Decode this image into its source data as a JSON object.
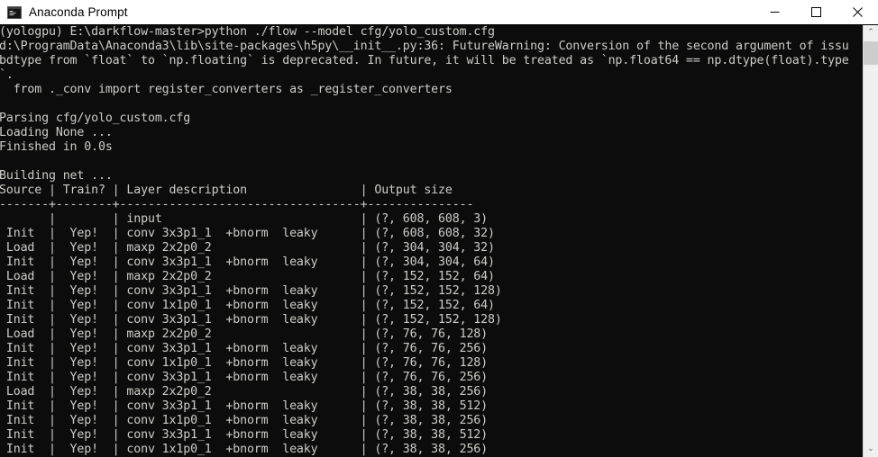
{
  "window": {
    "title": "Anaconda Prompt",
    "icon": "console-icon",
    "controls": {
      "minimize_label": "Minimize",
      "maximize_label": "Maximize",
      "close_label": "Close"
    }
  },
  "scrollbar": {
    "up_arrow": "⌃",
    "down_arrow": "⌄",
    "thumb_label": "scroll-thumb"
  },
  "console": {
    "prompt_line": "(yologpu) E:\\darkflow-master>python ./flow --model cfg/yolo_custom.cfg",
    "warning_lines": [
      "d:\\ProgramData\\Anaconda3\\lib\\site-packages\\h5py\\__init__.py:36: FutureWarning: Conversion of the second argument of issu",
      "bdtype from `float` to `np.floating` is deprecated. In future, it will be treated as `np.float64 == np.dtype(float).type",
      "`.",
      "  from ._conv import register_converters as _register_converters"
    ],
    "parse_lines": [
      "Parsing cfg/yolo_custom.cfg",
      "Loading None ...",
      "Finished in 0.0s"
    ],
    "building_line": "Building net ...",
    "table": {
      "header": "Source | Train? | Layer description                | Output size",
      "separator": "-------+--------+----------------------------------+---------------",
      "rows": [
        "       |        | input                            | (?, 608, 608, 3)",
        " Init  |  Yep!  | conv 3x3p1_1  +bnorm  leaky      | (?, 608, 608, 32)",
        " Load  |  Yep!  | maxp 2x2p0_2                     | (?, 304, 304, 32)",
        " Init  |  Yep!  | conv 3x3p1_1  +bnorm  leaky      | (?, 304, 304, 64)",
        " Load  |  Yep!  | maxp 2x2p0_2                     | (?, 152, 152, 64)",
        " Init  |  Yep!  | conv 3x3p1_1  +bnorm  leaky      | (?, 152, 152, 128)",
        " Init  |  Yep!  | conv 1x1p0_1  +bnorm  leaky      | (?, 152, 152, 64)",
        " Init  |  Yep!  | conv 3x3p1_1  +bnorm  leaky      | (?, 152, 152, 128)",
        " Load  |  Yep!  | maxp 2x2p0_2                     | (?, 76, 76, 128)",
        " Init  |  Yep!  | conv 3x3p1_1  +bnorm  leaky      | (?, 76, 76, 256)",
        " Init  |  Yep!  | conv 1x1p0_1  +bnorm  leaky      | (?, 76, 76, 128)",
        " Init  |  Yep!  | conv 3x3p1_1  +bnorm  leaky      | (?, 76, 76, 256)",
        " Load  |  Yep!  | maxp 2x2p0_2                     | (?, 38, 38, 256)",
        " Init  |  Yep!  | conv 3x3p1_1  +bnorm  leaky      | (?, 38, 38, 512)",
        " Init  |  Yep!  | conv 1x1p0_1  +bnorm  leaky      | (?, 38, 38, 256)",
        " Init  |  Yep!  | conv 3x3p1_1  +bnorm  leaky      | (?, 38, 38, 512)",
        " Init  |  Yep!  | conv 1x1p0_1  +bnorm  leaky      | (?, 38, 38, 256)"
      ]
    }
  },
  "colors": {
    "console_background": "#0c0c0c",
    "console_foreground": "#ccccc8",
    "titlebar_background": "#ffffff",
    "titlebar_foreground": "#000000",
    "scrollbar_track": "#f0f0f0",
    "scrollbar_thumb": "#cdcdcd"
  }
}
